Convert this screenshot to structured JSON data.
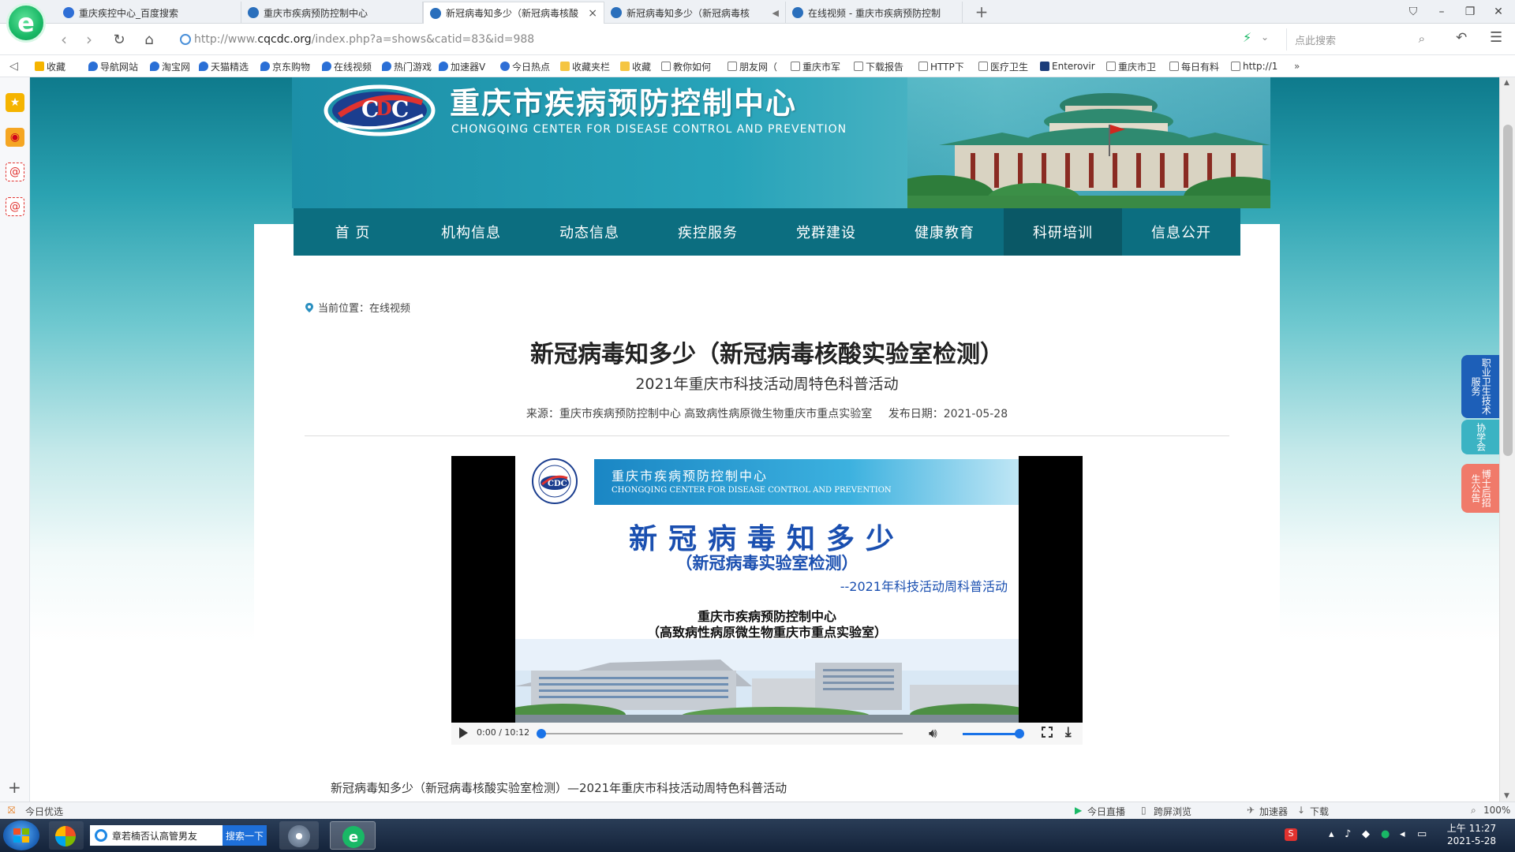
{
  "browser": {
    "tabs": [
      {
        "title": "重庆疾控中心_百度搜索",
        "active": false,
        "icon": "baidu-paw-icon"
      },
      {
        "title": "重庆市疾病预防控制中心",
        "active": false,
        "icon": "cdc-favicon"
      },
      {
        "title": "新冠病毒知多少（新冠病毒核酸",
        "active": true,
        "icon": "cdc-favicon"
      },
      {
        "title": "新冠病毒知多少（新冠病毒核",
        "active": false,
        "icon": "cdc-favicon",
        "audio": true
      },
      {
        "title": "在线视频 - 重庆市疾病预防控制",
        "active": false,
        "icon": "cdc-favicon"
      }
    ],
    "tab_close": "×",
    "new_tab": "+",
    "url_prefix": "http://www.",
    "url_domain": "cqcdc.org",
    "url_path": "/index.php?a=shows&catid=83&id=988",
    "search_placeholder": "点此搜索",
    "bookmarks": [
      {
        "label": "收藏",
        "icon": "star"
      },
      {
        "label": "导航网站",
        "icon": "drop"
      },
      {
        "label": "淘宝网",
        "icon": "drop"
      },
      {
        "label": "天猫精选",
        "icon": "drop"
      },
      {
        "label": "京东购物",
        "icon": "drop"
      },
      {
        "label": "在线视频",
        "icon": "drop"
      },
      {
        "label": "热门游戏",
        "icon": "drop"
      },
      {
        "label": "加速器V",
        "icon": "drop"
      },
      {
        "label": "今日热点",
        "icon": "paw"
      },
      {
        "label": "收藏夹栏",
        "icon": "folder"
      },
      {
        "label": "收藏",
        "icon": "folder"
      },
      {
        "label": "教你如何",
        "icon": "page"
      },
      {
        "label": "朋友网（",
        "icon": "page"
      },
      {
        "label": "重庆市军",
        "icon": "page"
      },
      {
        "label": "下载报告",
        "icon": "page"
      },
      {
        "label": "HTTP下",
        "icon": "page"
      },
      {
        "label": "医疗卫生",
        "icon": "page"
      },
      {
        "label": "Enterovir",
        "icon": "dark"
      },
      {
        "label": "重庆市卫",
        "icon": "page"
      },
      {
        "label": "每日有料",
        "icon": "page"
      },
      {
        "label": "http://1",
        "icon": "page"
      }
    ],
    "bookmarks_more": "»",
    "status_left": "今日优选",
    "status_right": [
      {
        "label": "今日直播"
      },
      {
        "label": "跨屏浏览"
      },
      {
        "label": "加速器"
      },
      {
        "label": "下载"
      },
      {
        "label": "100%"
      }
    ]
  },
  "site": {
    "name_cn": "重庆市疾病预防控制中心",
    "name_en": "CHONGQING CENTER FOR DISEASE CONTROL AND PREVENTION",
    "nav": [
      {
        "label": "首 页",
        "active": false
      },
      {
        "label": "机构信息",
        "active": false
      },
      {
        "label": "动态信息",
        "active": false
      },
      {
        "label": "疾控服务",
        "active": false
      },
      {
        "label": "党群建设",
        "active": false
      },
      {
        "label": "健康教育",
        "active": false
      },
      {
        "label": "科研培训",
        "active": true
      },
      {
        "label": "信息公开",
        "active": false
      }
    ],
    "float_buttons": [
      {
        "label": "职业卫生技术服务",
        "color": "#1d5fb8"
      },
      {
        "label": "协学会",
        "color": "#3bb3c3"
      },
      {
        "label": "博士后招生公告",
        "color": "#f07a6a"
      }
    ]
  },
  "article": {
    "breadcrumb": "当前位置：在线视频",
    "title": "新冠病毒知多少（新冠病毒核酸实验室检测）",
    "subtitle": "2021年重庆市科技活动周特色科普活动",
    "source": "来源：重庆市疾病预防控制中心 高致病性病原微生物重庆市重点实验室",
    "date": "发布日期：2021-05-28",
    "description": "新冠病毒知多少（新冠病毒核酸实验室检测）—2021年重庆市科技活动周特色科普活动"
  },
  "video": {
    "slide_org_cn": "重庆市疾病预防控制中心",
    "slide_org_en": "CHONGQING CENTER FOR DISEASE CONTROL AND PREVENTION",
    "slide_title": "新冠病毒知多少",
    "slide_subtitle": "（新冠病毒实验室检测）",
    "slide_event": "--2021年科技活动周科普活动",
    "slide_org_line1": "重庆市疾病预防控制中心",
    "slide_org_line2": "（高致病性病原微生物重庆市重点实验室）",
    "time": "0:00 / 10:12",
    "progress": 0,
    "volume": 1.0
  },
  "taskbar": {
    "search_text": "章若楠否认高管男友",
    "search_button": "搜索一下",
    "clock_time": "上午 11:27",
    "clock_date": "2021-5-28"
  }
}
